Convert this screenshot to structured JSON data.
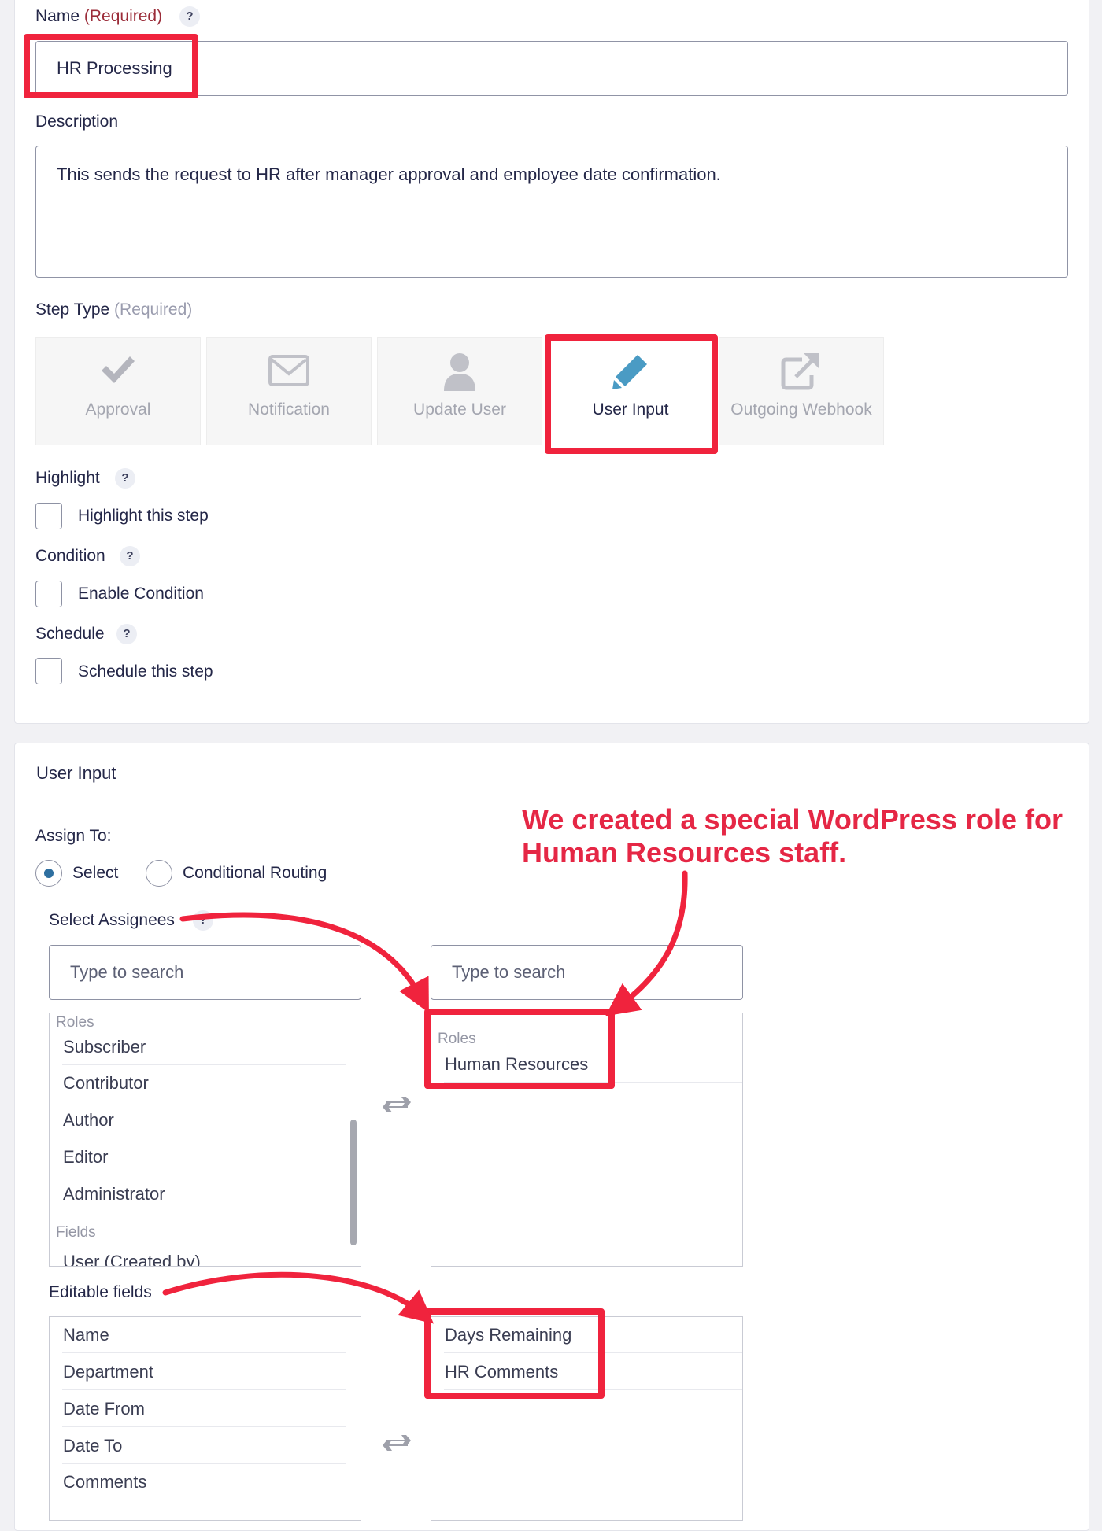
{
  "name_field": {
    "label": "Name",
    "required": "(Required)",
    "help": "?",
    "value": "HR Processing"
  },
  "description_field": {
    "label": "Description",
    "value": "This sends the request to HR after manager approval and employee date confirmation."
  },
  "step_type": {
    "label": "Step Type",
    "required": "(Required)",
    "options": [
      {
        "label": "Approval",
        "icon": "checkmark-icon",
        "selected": false
      },
      {
        "label": "Notification",
        "icon": "envelope-icon",
        "selected": false
      },
      {
        "label": "Update User",
        "icon": "user-icon",
        "selected": false
      },
      {
        "label": "User Input",
        "icon": "pencil-icon",
        "selected": true
      },
      {
        "label": "Outgoing Webhook",
        "icon": "external-link-icon",
        "selected": false
      }
    ]
  },
  "highlight": {
    "label": "Highlight",
    "help": "?",
    "checkbox_label": "Highlight this step",
    "checked": false
  },
  "condition": {
    "label": "Condition",
    "help": "?",
    "checkbox_label": "Enable Condition",
    "checked": false
  },
  "schedule": {
    "label": "Schedule",
    "help": "?",
    "checkbox_label": "Schedule this step",
    "checked": false
  },
  "user_input_section": {
    "title": "User Input",
    "assign_to": {
      "label": "Assign To:",
      "options": [
        {
          "label": "Select",
          "selected": true
        },
        {
          "label": "Conditional Routing",
          "selected": false
        }
      ]
    },
    "assignees": {
      "label": "Select Assignees",
      "left_search_placeholder": "Type to search",
      "right_search_placeholder": "Type to search",
      "left_groups": [
        {
          "group": "Roles",
          "items": [
            "Subscriber",
            "Contributor",
            "Author",
            "Editor",
            "Administrator"
          ]
        },
        {
          "group": "Fields",
          "items": [
            "User (Created by)"
          ]
        }
      ],
      "right_groups": [
        {
          "group": "Roles",
          "items": [
            "Human Resources"
          ]
        }
      ]
    },
    "editable_fields": {
      "label": "Editable fields",
      "left_items": [
        "Name",
        "Department",
        "Date From",
        "Date To",
        "Comments"
      ],
      "right_items": [
        "Days Remaining",
        "HR Comments"
      ]
    }
  },
  "annotation": {
    "line1": "We created a special WordPress role for",
    "line2": "Human Resources staff.",
    "color": "#e52745"
  },
  "colors": {
    "accent": "#2e6fa0",
    "highlight_red": "#f0233d",
    "required_red": "#9b2c39"
  }
}
